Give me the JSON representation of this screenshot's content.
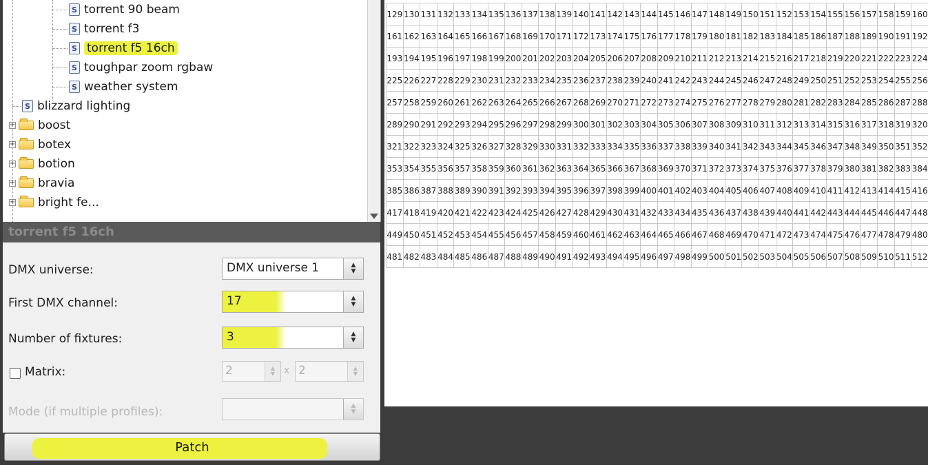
{
  "tree": {
    "items": [
      {
        "label": "torrent 90 beam",
        "type": "file",
        "level": 2,
        "highlighted": false
      },
      {
        "label": "torrent f3",
        "type": "file",
        "level": 2,
        "highlighted": false
      },
      {
        "label": "torrent f5 16ch",
        "type": "file",
        "level": 2,
        "highlighted": true
      },
      {
        "label": "toughpar zoom rgbaw",
        "type": "file",
        "level": 2,
        "highlighted": false
      },
      {
        "label": "weather system",
        "type": "file",
        "level": 2,
        "highlighted": false
      },
      {
        "label": "blizzard lighting",
        "type": "file",
        "level": 1,
        "highlighted": false
      },
      {
        "label": "boost",
        "type": "folder",
        "level": 1,
        "highlighted": false
      },
      {
        "label": "botex",
        "type": "folder",
        "level": 1,
        "highlighted": false
      },
      {
        "label": "botion",
        "type": "folder",
        "level": 1,
        "highlighted": false
      },
      {
        "label": "bravia",
        "type": "folder",
        "level": 1,
        "highlighted": false
      },
      {
        "label": "bright fe...",
        "type": "folder",
        "level": 1,
        "highlighted": false
      }
    ],
    "file_icon_glyph": "S",
    "expand_glyph": "+"
  },
  "panel_title": "torrent f5 16ch",
  "form": {
    "dmx_universe_label": "DMX universe:",
    "dmx_universe_value": "DMX universe 1",
    "first_channel_label": "First DMX channel:",
    "first_channel_value": "17",
    "num_fixtures_label": "Number of fixtures:",
    "num_fixtures_value": "3",
    "matrix_label": "Matrix:",
    "matrix_x": "2",
    "matrix_sep": "x",
    "matrix_y": "2",
    "mode_label": "Mode (if multiple profiles):",
    "mode_value": "",
    "spin_up": "▲",
    "spin_down": "▼"
  },
  "patch_button_label": "Patch",
  "grid": {
    "rows": [
      129,
      161,
      193,
      225,
      257,
      289,
      321,
      353,
      385,
      417,
      449,
      481
    ],
    "visible_columns": 32
  },
  "colors": {
    "highlight": "#ecf23f",
    "panel_dark": "#3c3c3c",
    "title_bar": "#5a5a5a"
  }
}
